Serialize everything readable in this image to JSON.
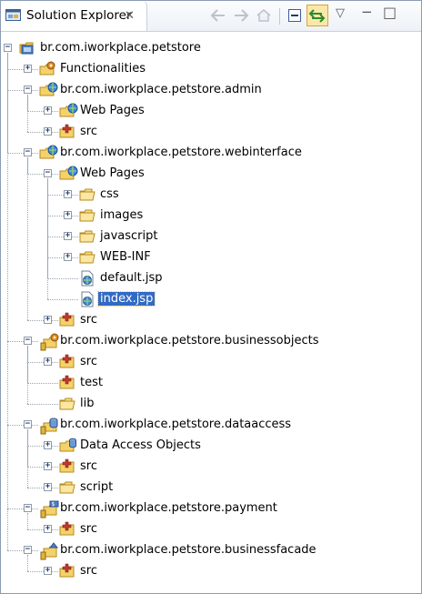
{
  "view": {
    "title": "Solution Explorer",
    "close_glyph": "✕",
    "menu_glyph": "▽",
    "minimize_glyph": "−",
    "maximize_glyph": "□",
    "toolbar": [
      "back-icon",
      "forward-icon",
      "home-icon",
      "collapse-all-icon",
      "link-with-editor-icon"
    ]
  },
  "tree": [
    {
      "label": "br.com.iworkplace.petstore",
      "icon": "solution-icon",
      "expander": "−"
    },
    {
      "label": "Functionalities",
      "icon": "functionalities-folder-icon",
      "expander": "+"
    },
    {
      "label": "br.com.iworkplace.petstore.admin",
      "icon": "web-project-icon",
      "expander": "−"
    },
    {
      "label": "Web Pages",
      "icon": "web-pages-folder-icon",
      "expander": "+"
    },
    {
      "label": "src",
      "icon": "source-folder-icon",
      "expander": "+"
    },
    {
      "label": "br.com.iworkplace.petstore.webinterface",
      "icon": "web-project-icon",
      "expander": "−"
    },
    {
      "label": "Web Pages",
      "icon": "web-pages-folder-icon",
      "expander": "−"
    },
    {
      "label": "css",
      "icon": "folder-icon",
      "expander": "+"
    },
    {
      "label": "images",
      "icon": "folder-icon",
      "expander": "+"
    },
    {
      "label": "javascript",
      "icon": "folder-icon",
      "expander": "+"
    },
    {
      "label": "WEB-INF",
      "icon": "folder-icon",
      "expander": "+"
    },
    {
      "label": "default.jsp",
      "icon": "jsp-file-icon",
      "expander": ""
    },
    {
      "label": "index.jsp",
      "icon": "jsp-file-icon",
      "expander": "",
      "selected": true
    },
    {
      "label": "src",
      "icon": "source-folder-icon",
      "expander": "+"
    },
    {
      "label": "br.com.iworkplace.petstore.businessobjects",
      "icon": "business-objects-project-icon",
      "expander": "−"
    },
    {
      "label": "src",
      "icon": "source-folder-icon",
      "expander": "+"
    },
    {
      "label": "test",
      "icon": "source-folder-icon",
      "expander": ""
    },
    {
      "label": "lib",
      "icon": "folder-icon",
      "expander": ""
    },
    {
      "label": "br.com.iworkplace.petstore.dataaccess",
      "icon": "data-access-project-icon",
      "expander": "−"
    },
    {
      "label": "Data Access Objects",
      "icon": "data-access-folder-icon",
      "expander": "+"
    },
    {
      "label": "src",
      "icon": "source-folder-icon",
      "expander": "+"
    },
    {
      "label": "script",
      "icon": "folder-icon",
      "expander": "+"
    },
    {
      "label": "br.com.iworkplace.petstore.payment",
      "icon": "payment-project-icon",
      "expander": "−"
    },
    {
      "label": "src",
      "icon": "source-folder-icon",
      "expander": "+"
    },
    {
      "label": "br.com.iworkplace.petstore.businessfacade",
      "icon": "business-facade-project-icon",
      "expander": "−"
    },
    {
      "label": "src",
      "icon": "source-folder-icon",
      "expander": "+"
    }
  ]
}
